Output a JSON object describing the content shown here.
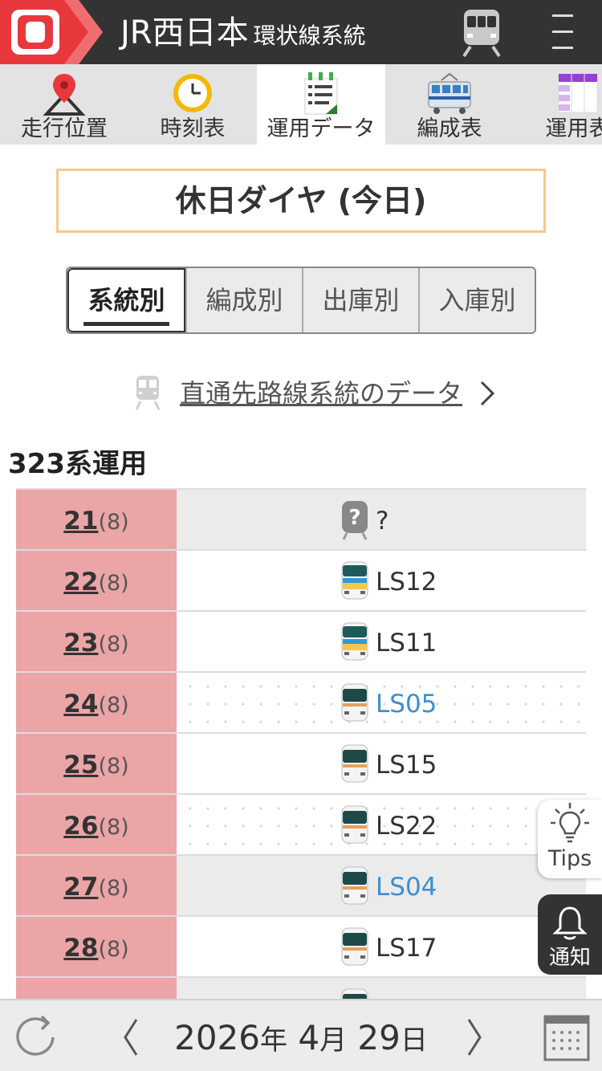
{
  "header": {
    "logo_text": "O",
    "title": "JR西日本",
    "subtitle": "環状線系統",
    "train_icon": "train-front-icon",
    "menu_icon": "menu-icon"
  },
  "tabs": [
    {
      "label": "走行位置",
      "icon": "map-pin-icon",
      "active": false
    },
    {
      "label": "時刻表",
      "icon": "clock-icon",
      "active": false
    },
    {
      "label": "運用データ",
      "icon": "data-list-icon",
      "active": true
    },
    {
      "label": "編成表",
      "icon": "train-side-icon",
      "active": false
    },
    {
      "label": "運用表",
      "icon": "grid-table-icon",
      "active": false
    }
  ],
  "diagram_label": "休日ダイヤ (今日)",
  "segments": [
    {
      "label": "系統別",
      "active": true
    },
    {
      "label": "編成別",
      "active": false
    },
    {
      "label": "出庫別",
      "active": false
    },
    {
      "label": "入庫別",
      "active": false
    }
  ],
  "through_link": "直通先路線系統のデータ",
  "section_title": "323系運用",
  "operations": [
    {
      "number": "21",
      "cars": "(8)",
      "formation": "?",
      "icon": "unknown-train-icon",
      "link": false,
      "style": "gray"
    },
    {
      "number": "22",
      "cars": "(8)",
      "formation": "LS12",
      "icon": "train-323-wrapped-icon",
      "link": false,
      "style": "white"
    },
    {
      "number": "23",
      "cars": "(8)",
      "formation": "LS11",
      "icon": "train-323-wrapped-icon",
      "link": false,
      "style": "white"
    },
    {
      "number": "24",
      "cars": "(8)",
      "formation": "LS05",
      "icon": "train-323-icon",
      "link": true,
      "style": "dotted"
    },
    {
      "number": "25",
      "cars": "(8)",
      "formation": "LS15",
      "icon": "train-323-icon",
      "link": false,
      "style": "white"
    },
    {
      "number": "26",
      "cars": "(8)",
      "formation": "LS22",
      "icon": "train-323-icon",
      "link": false,
      "style": "dotted"
    },
    {
      "number": "27",
      "cars": "(8)",
      "formation": "LS04",
      "icon": "train-323-icon",
      "link": true,
      "style": "gray"
    },
    {
      "number": "28",
      "cars": "(8)",
      "formation": "LS17",
      "icon": "train-323-icon",
      "link": false,
      "style": "white"
    },
    {
      "number": "",
      "cars": "",
      "formation": "",
      "icon": "train-323-icon",
      "link": false,
      "style": "gray"
    }
  ],
  "floating": {
    "tips": "Tips",
    "notify": "通知"
  },
  "bottom": {
    "year": "2026",
    "year_unit": "年",
    "month": " 4",
    "month_unit": "月",
    "day": " 29",
    "day_unit": "日"
  },
  "colors": {
    "header_bg": "#333333",
    "logo_red": "#e8383d",
    "op_number_bg": "#eba5a7",
    "link_blue": "#3d8fd0",
    "diagram_border": "#f5c88c"
  }
}
